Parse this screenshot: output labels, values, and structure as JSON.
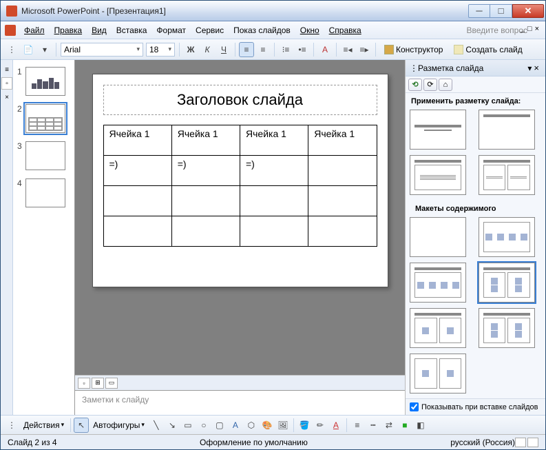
{
  "window": {
    "title": "Microsoft PowerPoint - [Презентация1]"
  },
  "menu": {
    "file": "Файл",
    "edit": "Правка",
    "view": "Вид",
    "insert": "Вставка",
    "format": "Формат",
    "tools": "Сервис",
    "slideshow": "Показ слайдов",
    "window": "Окно",
    "help": "Справка",
    "help_placeholder": "Введите вопрос"
  },
  "toolbar": {
    "font": "Arial",
    "size": "18",
    "designer": "Конструктор",
    "new_slide": "Создать слайд"
  },
  "thumbs": [
    {
      "num": "1"
    },
    {
      "num": "2"
    },
    {
      "num": "3"
    },
    {
      "num": "4"
    }
  ],
  "slide": {
    "title": "Заголовок слайда",
    "table": [
      [
        "Ячейка 1",
        "Ячейка 1",
        "Ячейка 1",
        "Ячейка 1"
      ],
      [
        "=)",
        "=)",
        "=)",
        ""
      ],
      [
        "",
        "",
        "",
        ""
      ],
      [
        "",
        "",
        "",
        ""
      ]
    ]
  },
  "notes": {
    "placeholder": "Заметки к слайду"
  },
  "taskpane": {
    "title": "Разметка слайда",
    "apply_label": "Применить разметку слайда:",
    "content_layouts": "Макеты содержимого",
    "show_on_insert": "Показывать при вставке слайдов"
  },
  "draw": {
    "actions": "Действия",
    "autoshapes": "Автофигуры"
  },
  "status": {
    "slide": "Слайд 2 из 4",
    "design": "Оформление по умолчанию",
    "lang": "русский (Россия)"
  }
}
